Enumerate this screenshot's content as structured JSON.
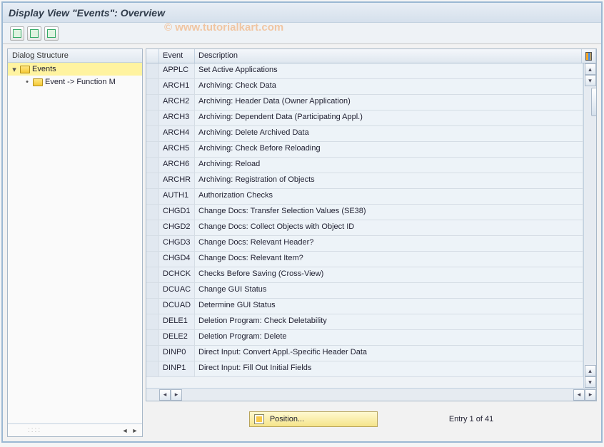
{
  "title": "Display View \"Events\": Overview",
  "watermark": "© www.tutorialkart.com",
  "sidebar": {
    "header": "Dialog Structure",
    "items": [
      {
        "label": "Events",
        "expanded": true,
        "selected": true
      },
      {
        "label": "Event -> Function M",
        "expanded": false,
        "selected": false
      }
    ]
  },
  "table": {
    "headers": {
      "event": "Event",
      "description": "Description"
    },
    "rows": [
      {
        "event": "APPLC",
        "desc": "Set Active Applications"
      },
      {
        "event": "ARCH1",
        "desc": "Archiving: Check Data"
      },
      {
        "event": "ARCH2",
        "desc": "Archiving: Header Data (Owner Application)"
      },
      {
        "event": "ARCH3",
        "desc": "Archiving: Dependent Data (Participating Appl.)"
      },
      {
        "event": "ARCH4",
        "desc": "Archiving: Delete Archived Data"
      },
      {
        "event": "ARCH5",
        "desc": "Archiving: Check Before Reloading"
      },
      {
        "event": "ARCH6",
        "desc": "Archiving: Reload"
      },
      {
        "event": "ARCHR",
        "desc": "Archiving: Registration of Objects"
      },
      {
        "event": "AUTH1",
        "desc": "Authorization Checks"
      },
      {
        "event": "CHGD1",
        "desc": "Change Docs: Transfer Selection Values (SE38)"
      },
      {
        "event": "CHGD2",
        "desc": "Change Docs: Collect Objects with Object ID"
      },
      {
        "event": "CHGD3",
        "desc": "Change Docs: Relevant Header?"
      },
      {
        "event": "CHGD4",
        "desc": "Change Docs: Relevant Item?"
      },
      {
        "event": "DCHCK",
        "desc": "Checks Before Saving (Cross-View)"
      },
      {
        "event": "DCUAC",
        "desc": "Change GUI Status"
      },
      {
        "event": "DCUAD",
        "desc": "Determine GUI Status"
      },
      {
        "event": "DELE1",
        "desc": "Deletion Program: Check Deletability"
      },
      {
        "event": "DELE2",
        "desc": "Deletion Program: Delete"
      },
      {
        "event": "DINP0",
        "desc": "Direct Input: Convert Appl.-Specific Header Data"
      },
      {
        "event": "DINP1",
        "desc": "Direct Input: Fill Out Initial Fields"
      }
    ]
  },
  "footer": {
    "position_label": "Position...",
    "entry_status": "Entry 1 of 41"
  }
}
